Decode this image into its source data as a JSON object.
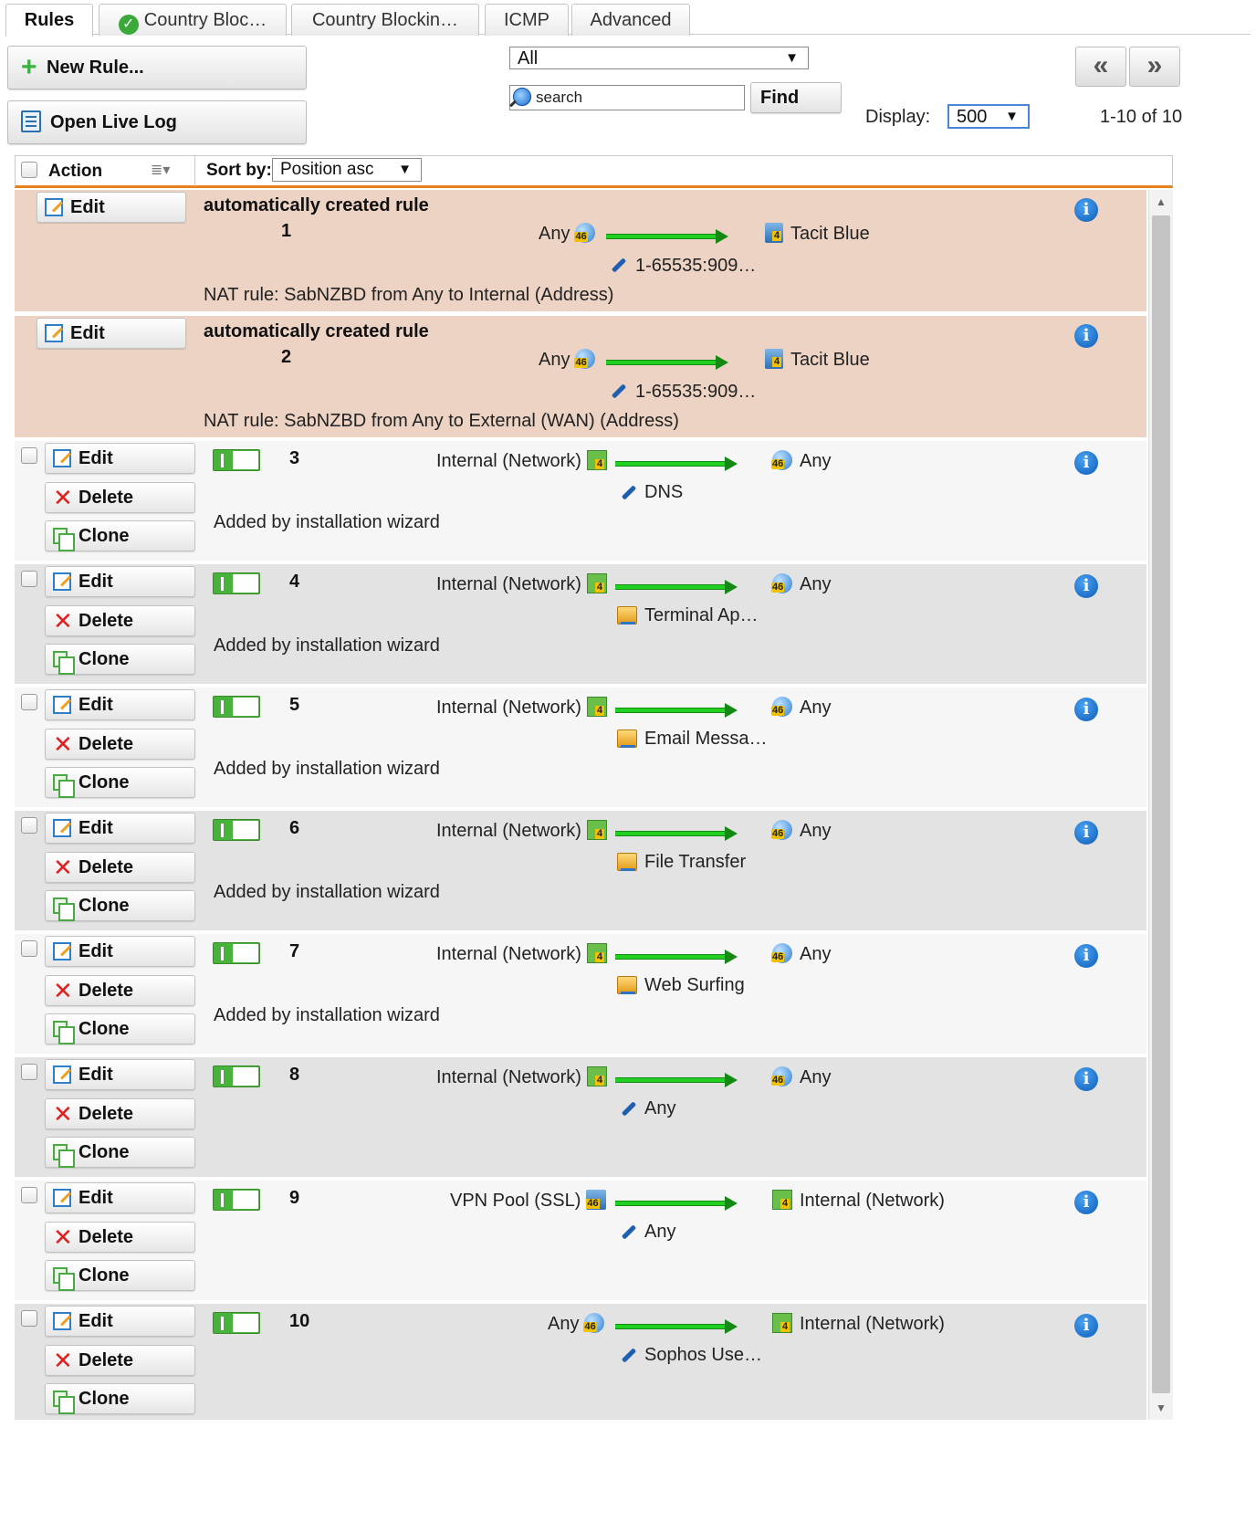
{
  "tabs": [
    {
      "label": "Rules",
      "active": true
    },
    {
      "label": "Country Bloc…",
      "icon": "check-circle-icon"
    },
    {
      "label": "Country Blockin…"
    },
    {
      "label": "ICMP"
    },
    {
      "label": "Advanced"
    }
  ],
  "toolbar": {
    "new_rule": "New Rule...",
    "open_live_log": "Open Live Log",
    "filter_value": "All",
    "search_placeholder": "search",
    "find": "Find",
    "display_label": "Display:",
    "display_value": "500",
    "prev_page": "«",
    "next_page": "»",
    "range": "1-10 of 10"
  },
  "header": {
    "action": "Action",
    "sort_label": "Sort by:",
    "sort_value": "Position asc"
  },
  "buttons": {
    "edit": "Edit",
    "delete": "Delete",
    "clone": "Clone"
  },
  "nat_rules": [
    {
      "title": "automatically created rule",
      "position": "1",
      "source": "Any",
      "destination": "Tacit Blue",
      "service": "1-65535:909…",
      "comment": "NAT rule: SabNZBD from Any to Internal (Address)"
    },
    {
      "title": "automatically created rule",
      "position": "2",
      "source": "Any",
      "destination": "Tacit Blue",
      "service": "1-65535:909…",
      "comment": "NAT rule: SabNZBD from Any to External (WAN) (Address)"
    }
  ],
  "rules": [
    {
      "position": "3",
      "source": "Internal (Network)",
      "destination": "Any",
      "service": "DNS",
      "comment": "Added by installation wizard"
    },
    {
      "position": "4",
      "source": "Internal (Network)",
      "destination": "Any",
      "service": "Terminal Ap…",
      "comment": "Added by installation wizard"
    },
    {
      "position": "5",
      "source": "Internal (Network)",
      "destination": "Any",
      "service": "Email Messa…",
      "comment": "Added by installation wizard"
    },
    {
      "position": "6",
      "source": "Internal (Network)",
      "destination": "Any",
      "service": "File Transfer",
      "comment": "Added by installation wizard"
    },
    {
      "position": "7",
      "source": "Internal (Network)",
      "destination": "Any",
      "service": "Web Surfing",
      "comment": "Added by installation wizard"
    },
    {
      "position": "8",
      "source": "Internal (Network)",
      "destination": "Any",
      "service": "Any",
      "comment": ""
    },
    {
      "position": "9",
      "source": "VPN Pool (SSL)",
      "destination": "Internal (Network)",
      "service": "Any",
      "comment": ""
    },
    {
      "position": "10",
      "source": "Any",
      "destination": "Internal (Network)",
      "service": "Sophos Use…",
      "comment": ""
    }
  ],
  "colors": {
    "accent_orange": "#e8801c",
    "nat_row": "#ecd3c3",
    "toggle_green": "#48b33a",
    "arrow_green": "#22d022"
  }
}
